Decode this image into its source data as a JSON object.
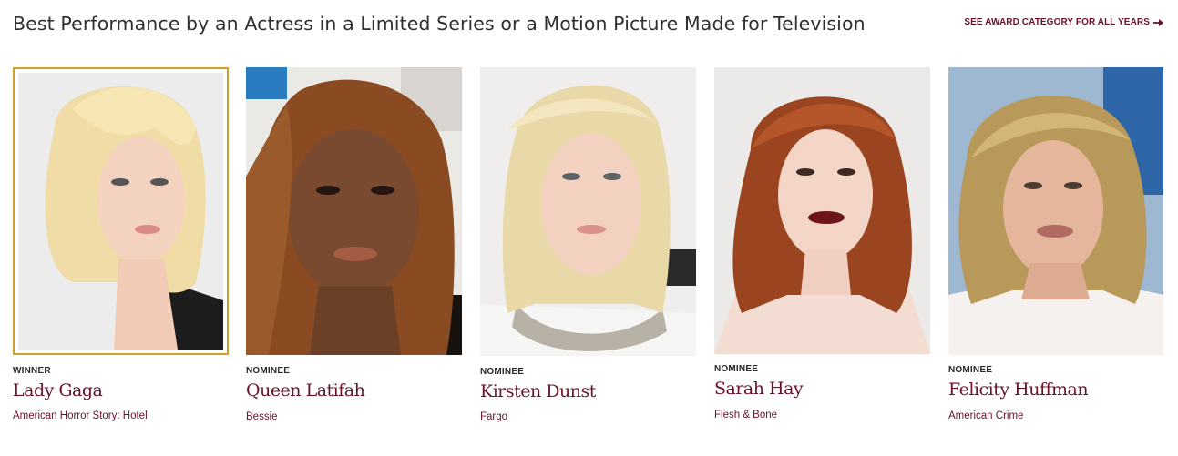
{
  "header": {
    "title": "Best Performance by an Actress in a Limited Series or a Motion Picture Made for Television",
    "all_years_link": "SEE AWARD CATEGORY FOR ALL YEARS",
    "arrow_icon": "arrow-right-icon"
  },
  "colors": {
    "accent": "#6b1229",
    "winner_border": "#c9a227",
    "title_text": "#2f2f2f"
  },
  "nominees": [
    {
      "status": "WINNER",
      "name": "Lady Gaga",
      "work": "American Horror Story: Hotel"
    },
    {
      "status": "NOMINEE",
      "name": "Queen Latifah",
      "work": "Bessie"
    },
    {
      "status": "NOMINEE",
      "name": "Kirsten Dunst",
      "work": "Fargo"
    },
    {
      "status": "NOMINEE",
      "name": "Sarah Hay",
      "work": "Flesh & Bone"
    },
    {
      "status": "NOMINEE",
      "name": "Felicity Huffman",
      "work": "American Crime"
    }
  ]
}
